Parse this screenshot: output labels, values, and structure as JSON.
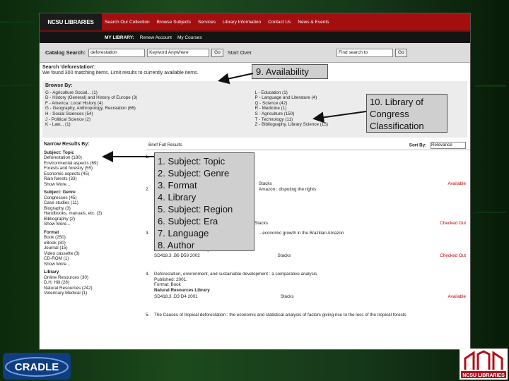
{
  "header": {
    "logo": "NCSU LIBRARIES",
    "nav": [
      "Search Our Collection",
      "Browse Subjects",
      "Services",
      "Library Information",
      "Contact Us",
      "News & Events"
    ]
  },
  "subheader": {
    "label": "MY LIBRARY:",
    "links": [
      "Renew Account",
      "My Courses"
    ]
  },
  "search": {
    "label": "Catalog Search:",
    "value": "deforestation",
    "type": "Keyword Anywhere",
    "go": "Go",
    "start_over": "Start Over",
    "find_label": "Find search to",
    "go2": "Go"
  },
  "status": {
    "line1": "Search 'deforestation':",
    "line2": "We found 300 matching items. Limit results to currently available items."
  },
  "browse": {
    "title": "Browse By:",
    "left": [
      "G - Agriculture Social... (1)",
      "D - History (General) and History of Europe (3)",
      "F - America: Local History (4)",
      "G - Geography, Anthropology, Recreation (66)",
      "H - Social Sciences (54)",
      "J - Political Science (2)",
      "K - Law... (1)"
    ],
    "right": [
      "L - Education (1)",
      "P - Language and Literature (4)",
      "Q - Science (42)",
      "R - Medicine (1)",
      "S - Agriculture (150)",
      "T - Technology (11)",
      "Z - Bibliography, Library Science (15)"
    ]
  },
  "narrow": {
    "title": "Narrow Results By:",
    "groups": [
      {
        "name": "Subject: Topic",
        "items": [
          "Deforestation (180)",
          "Environmental aspects (69)",
          "Forests and forestry (55)",
          "Economic aspects (45)",
          "Rain forests (33)",
          "Show More..."
        ]
      },
      {
        "name": "Subject: Genre",
        "items": [
          "Congresses (45)",
          "Case studies (11)",
          "Biography (3)",
          "Handbooks, manuals, etc. (3)",
          "Bibliography (2)",
          "Show More..."
        ]
      },
      {
        "name": "Format",
        "items": [
          "Book (250)",
          "eBook (30)",
          "Journal (15)",
          "Video cassette (3)",
          "CD-ROM (1)",
          "Show More..."
        ]
      },
      {
        "name": "Library",
        "items": [
          "Online Resources (30)",
          "D.H. Hill (28)",
          "Natural Resources (242)",
          "Veterinary Medical (1)"
        ]
      }
    ]
  },
  "results": {
    "header": "Brief Full Results",
    "sort_label": "Sort By:",
    "sort_value": "Relevance",
    "records": [
      {
        "num": "1.",
        "title": "",
        "published": "",
        "format": "",
        "library": "",
        "call": "",
        "loc": "Stacks",
        "status": "Available"
      },
      {
        "num": "2.",
        "title": "Amazon : disputing the rights",
        "published": "",
        "format": "",
        "library": "",
        "call": "",
        "loc": "Stacks",
        "status": "Checked Out"
      },
      {
        "num": "3.",
        "title": "...economic growth in the Brazilian Amazon",
        "published": "Published: 2001.",
        "format": "Format: Book",
        "library": "Natural Resources Library",
        "call": "SD418.3 .B6 D59 2002",
        "loc": "Stacks",
        "status": "Checked Out"
      },
      {
        "num": "4.",
        "title": "Deforestation, environment, and sustainable development : a comparative analysis",
        "published": "Published: 2001.",
        "format": "Format: Book",
        "library": "Natural Resources Library",
        "call": "SD418.3 .D3 D4 2001",
        "loc": "Stacks",
        "status": "Available"
      },
      {
        "num": "5.",
        "title": "The Causes of tropical deforestation : the economic and statistical analysis of factors giving rise to the loss of the tropical forests",
        "published": "",
        "format": "",
        "library": "",
        "call": "",
        "loc": "",
        "status": ""
      }
    ]
  },
  "callouts": {
    "availability": "9. Availability",
    "classification": [
      "10. Library of",
      "Congress",
      "Classification"
    ],
    "facets": [
      "1. Subject: Topic",
      "2. Subject: Genre",
      "3. Format",
      "4. Library",
      "5. Subject: Region",
      "6. Subject: Era",
      "7. Language",
      "8. Author"
    ]
  },
  "logos": {
    "cradle": "CRADLE",
    "ncsu": "NCSU LIBRARIES"
  },
  "colors": {
    "background": "#1d4a1d",
    "brand_red": "#a30f0f",
    "callout": "#cfcfcf"
  }
}
